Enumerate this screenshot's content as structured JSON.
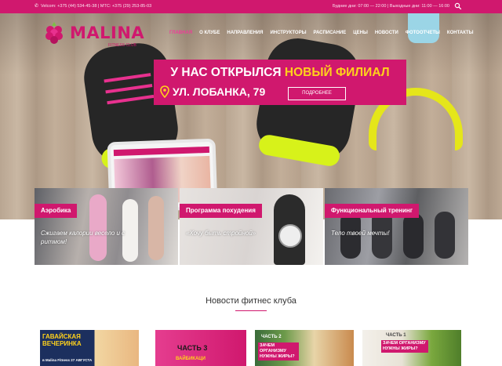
{
  "topbar": {
    "phones": "Velcom: +375 (44) 534-45-38 | МТС: +375 (29) 253-85-03",
    "hours": "Будние дни: 07:00 — 22:00  |  Выходные дни: 11:00 — 16:00"
  },
  "logo": {
    "name": "MALINA",
    "tagline": "FITNESS CLUB"
  },
  "nav": {
    "items": [
      "ГЛАВНАЯ",
      "О КЛУБЕ",
      "НАПРАВЛЕНИЯ",
      "ИНСТРУКТОРЫ",
      "РАСПИСАНИЕ",
      "ЦЕНЫ",
      "НОВОСТИ",
      "ФОТООТЧЕТЫ",
      "КОНТАКТЫ"
    ],
    "active_index": 0
  },
  "promo": {
    "line1_part1": "У НАС ОТКРЫЛСЯ",
    "line1_highlight": "НОВЫЙ ФИЛИАЛ",
    "address": "УЛ. ЛОБАНКА, 79",
    "button": "ПОДРОБНЕЕ"
  },
  "cards": [
    {
      "title": "Аэробика",
      "desc": "Сжигаем калории весело и с ритмом!"
    },
    {
      "title": "Программа похудения",
      "desc": "«Хочу быть стройной»"
    },
    {
      "title": "Функциональный тренинг",
      "desc": "Тело твоей мечты!"
    }
  ],
  "news": {
    "title": "Новости фитнес клуба",
    "items": [
      {
        "caption": "ГАВАЙСКАЯ ВЕЧЕРИНКА",
        "sub": "в Malina Fitness 27 АВГУСТА"
      },
      {
        "caption": "ЧАСТЬ 3",
        "sub": "ВАЙБИКАЦИ"
      },
      {
        "caption": "ЧАСТЬ 2",
        "sub": "ЗАЧЕМ ОРГАНИЗМУ НУЖНЫ ЖИРЫ?"
      },
      {
        "caption": "ЧАСТЬ 1",
        "sub": "ЗАЧЕМ ОРГАНИЗМУ НУЖНЫ ЖИРЫ?"
      }
    ]
  },
  "colors": {
    "brand": "#d0186e",
    "highlight": "#ffd21b",
    "sole": "#d7f21a"
  }
}
